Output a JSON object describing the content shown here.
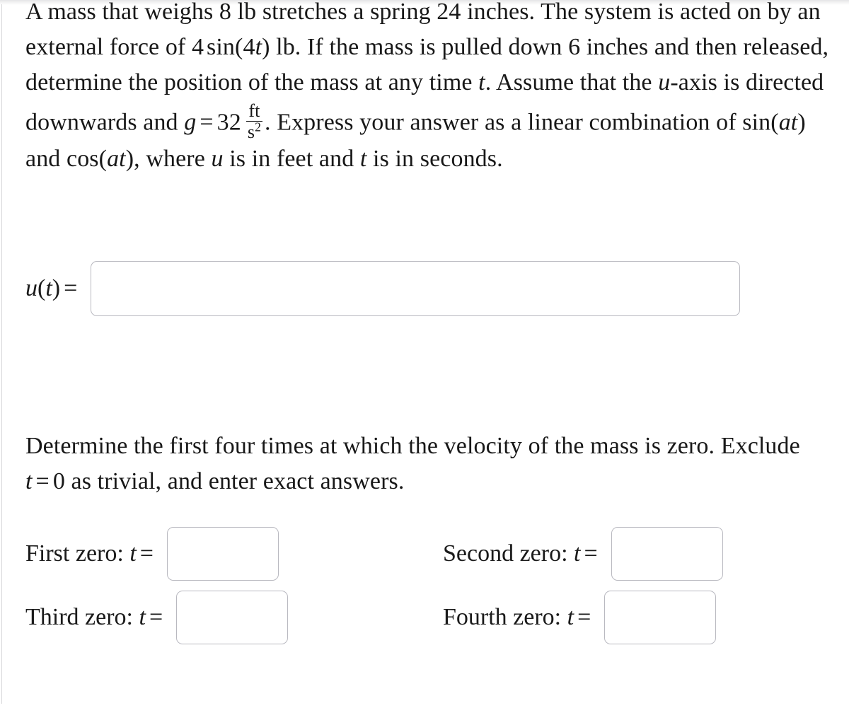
{
  "problem": {
    "paragraph1": {
      "s1": "A mass that weighs 8 lb stretches a spring 24 inches. The system is acted on by an external force of ",
      "force_coeff": "4",
      "force_fn": "sin",
      "force_open": "(",
      "force_arg_num": "4",
      "force_arg_var": "t",
      "force_close": ")",
      "s2": " lb. If the mass is pulled down 6 inches and then released, determine the position of the mass at any time ",
      "var_t": "t",
      "s3": ". Assume that the ",
      "var_u": "u",
      "s4": "-axis is directed downwards and ",
      "g_symbol": "g",
      "g_equals": "=",
      "g_value": "32",
      "g_unit_numerator": "ft",
      "g_unit_denominator": "s",
      "g_unit_exponent": "2",
      "s5": ". Express your answer as a linear combination of ",
      "sin_fn": "sin",
      "sin_open": "(",
      "sin_arg_a": "a",
      "sin_arg_t": "t",
      "sin_close": ")",
      "s6": " and ",
      "cos_fn": "cos",
      "cos_open": "(",
      "cos_arg_a": "a",
      "cos_arg_t": "t",
      "cos_close": ")",
      "s7": ", where ",
      "var_u2": "u",
      "s8": " is in feet and ",
      "var_t2": "t",
      "s9": " is in seconds."
    },
    "paragraph2": {
      "s1": "Determine the first four times at which the velocity of the mass is zero. Exclude ",
      "var_t": "t",
      "eq": "=",
      "zero": "0",
      "s2": " as trivial, and enter exact answers."
    }
  },
  "answers": {
    "position": {
      "label_fn": "u",
      "label_open": "(",
      "label_var": "t",
      "label_close": ")",
      "label_equals": "=",
      "value": "",
      "placeholder": ""
    },
    "zeros": [
      {
        "name": "first-zero",
        "label_text": "First zero: ",
        "label_var": "t",
        "label_equals": "=",
        "value": "",
        "placeholder": ""
      },
      {
        "name": "second-zero",
        "label_text": "Second zero: ",
        "label_var": "t",
        "label_equals": "=",
        "value": "",
        "placeholder": ""
      },
      {
        "name": "third-zero",
        "label_text": "Third zero: ",
        "label_var": "t",
        "label_equals": "=",
        "value": "",
        "placeholder": ""
      },
      {
        "name": "fourth-zero",
        "label_text": "Fourth zero: ",
        "label_var": "t",
        "label_equals": "=",
        "value": "",
        "placeholder": ""
      }
    ]
  },
  "colors": {
    "text": "#181818",
    "input_border": "#b9b9c0",
    "page_background": "#ffffff",
    "left_rule": "#d7d7da"
  }
}
